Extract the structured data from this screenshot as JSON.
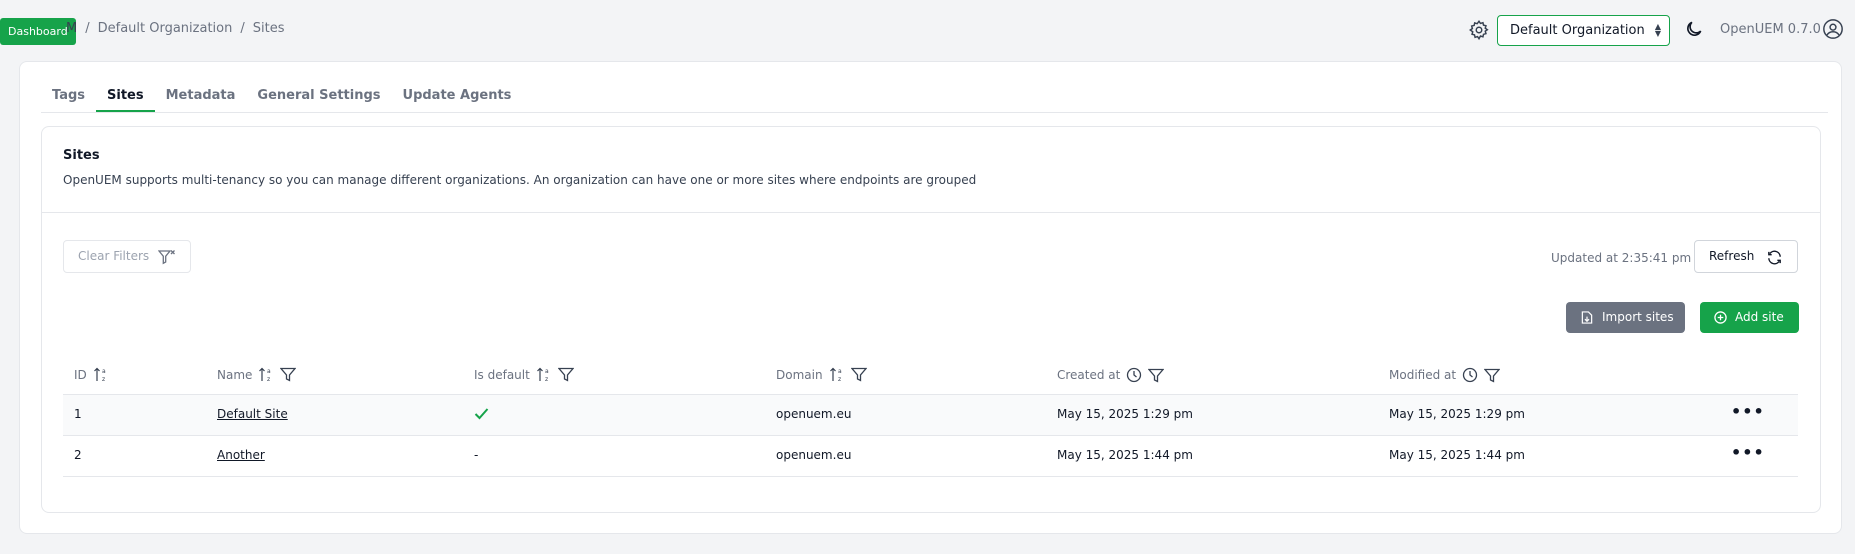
{
  "topbar": {
    "badge": "Dashboard",
    "breadcrumb_first": "M",
    "breadcrumb_sep": "/",
    "breadcrumb_org": "Default Organization",
    "breadcrumb_page": "Sites",
    "org_select_value": "Default Organization",
    "version": "OpenUEM 0.7.0"
  },
  "tabs": [
    {
      "label": "Tags",
      "active": false
    },
    {
      "label": "Sites",
      "active": true
    },
    {
      "label": "Metadata",
      "active": false
    },
    {
      "label": "General Settings",
      "active": false
    },
    {
      "label": "Update Agents",
      "active": false
    }
  ],
  "section": {
    "title": "Sites",
    "description": "OpenUEM supports multi-tenancy so you can manage different organizations. An organization can have one or more sites where endpoints are grouped"
  },
  "toolbar": {
    "clear_filters": "Clear Filters",
    "updated": "Updated at 2:35:41 pm",
    "refresh": "Refresh",
    "import_sites": "Import sites",
    "add_site": "Add site"
  },
  "table": {
    "headers": {
      "id": "ID",
      "name": "Name",
      "is_default": "Is default",
      "domain": "Domain",
      "created_at": "Created at",
      "modified_at": "Modified at"
    },
    "rows": [
      {
        "id": "1",
        "name": "Default Site",
        "is_default": "check",
        "domain": "openuem.eu",
        "created_at": "May 15, 2025 1:29 pm",
        "modified_at": "May 15, 2025 1:29 pm"
      },
      {
        "id": "2",
        "name": "Another",
        "is_default": "-",
        "domain": "openuem.eu",
        "created_at": "May 15, 2025 1:44 pm",
        "modified_at": "May 15, 2025 1:44 pm"
      }
    ],
    "row_actions": "•••"
  },
  "colors": {
    "accent": "#16a34a",
    "secondary_button": "#6b7280"
  }
}
